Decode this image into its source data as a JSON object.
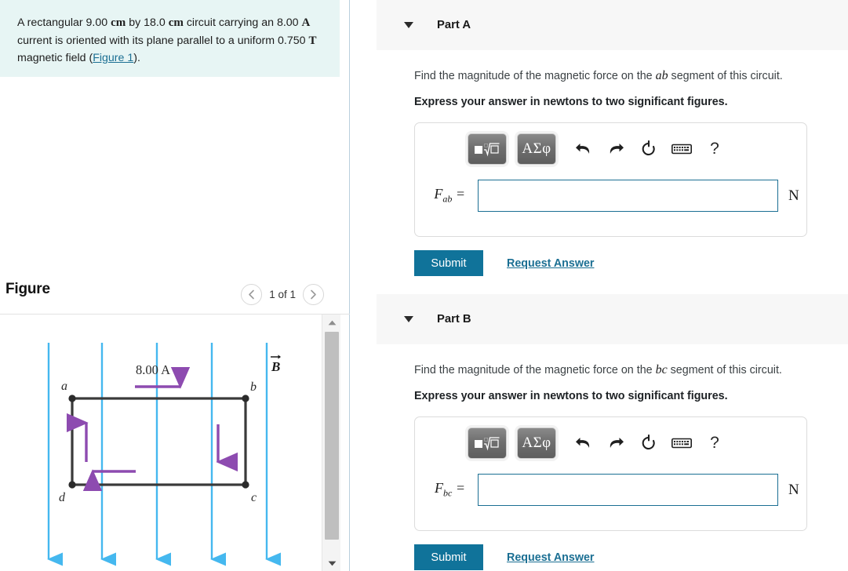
{
  "problem": {
    "text_before_1": "A rectangular ",
    "dim1": "9.00",
    "unit1": "cm",
    "text_by": " by ",
    "dim2": "18.0",
    "unit2": "cm",
    "text_circuit": " circuit carrying an ",
    "current": "8.00",
    "unit_current": "A",
    "text_middle": " current is oriented with its plane parallel to a uniform ",
    "field": "0.750",
    "unit_field": "T",
    "text_after": " magnetic field (",
    "figure_link": "Figure 1",
    "text_end": ")."
  },
  "figure": {
    "title": "Figure",
    "page_indicator": "1 of 1",
    "prev_icon": "chevron-left-icon",
    "next_icon": "chevron-right-icon",
    "labels": {
      "a": "a",
      "b": "b",
      "c": "c",
      "d": "d",
      "current": "8.00 A",
      "field": "B"
    },
    "colors": {
      "field_line": "#45b8ef",
      "current_arrow": "#8d4bb0",
      "circuit": "#3a3a3a"
    }
  },
  "parts": [
    {
      "id": "part-a",
      "label": "Part A",
      "question_prefix": "Find the magnitude of the magnetic force on the ",
      "segment": "ab",
      "question_suffix": " segment  of this circuit.",
      "instruction": "Express your answer in newtons to two significant figures.",
      "variable": "F",
      "subscript": "ab",
      "equals": "=",
      "value": "",
      "placeholder": "",
      "unit": "N",
      "submit_label": "Submit",
      "request_label": "Request Answer",
      "toolbar": {
        "template_button": "math-template-button",
        "greek_button": "ΑΣφ",
        "undo_icon": "undo-icon",
        "redo_icon": "redo-icon",
        "reset_icon": "reset-icon",
        "keyboard_icon": "keyboard-icon",
        "help_icon": "?"
      }
    },
    {
      "id": "part-b",
      "label": "Part B",
      "question_prefix": "Find the magnitude of the magnetic force on the ",
      "segment": "bc",
      "question_suffix": " segment of this circuit.",
      "instruction": "Express your answer in newtons to two significant figures.",
      "variable": "F",
      "subscript": "bc",
      "equals": "=",
      "value": "",
      "placeholder": "",
      "unit": "N",
      "submit_label": "Submit",
      "request_label": "Request Answer",
      "toolbar": {
        "template_button": "math-template-button",
        "greek_button": "ΑΣφ",
        "undo_icon": "undo-icon",
        "redo_icon": "redo-icon",
        "reset_icon": "reset-icon",
        "keyboard_icon": "keyboard-icon",
        "help_icon": "?"
      }
    }
  ],
  "theme": {
    "accent": "#10739a",
    "link": "#1b6f93",
    "problem_bg": "#e7f5f4",
    "header_bg": "#f7f7f7"
  }
}
